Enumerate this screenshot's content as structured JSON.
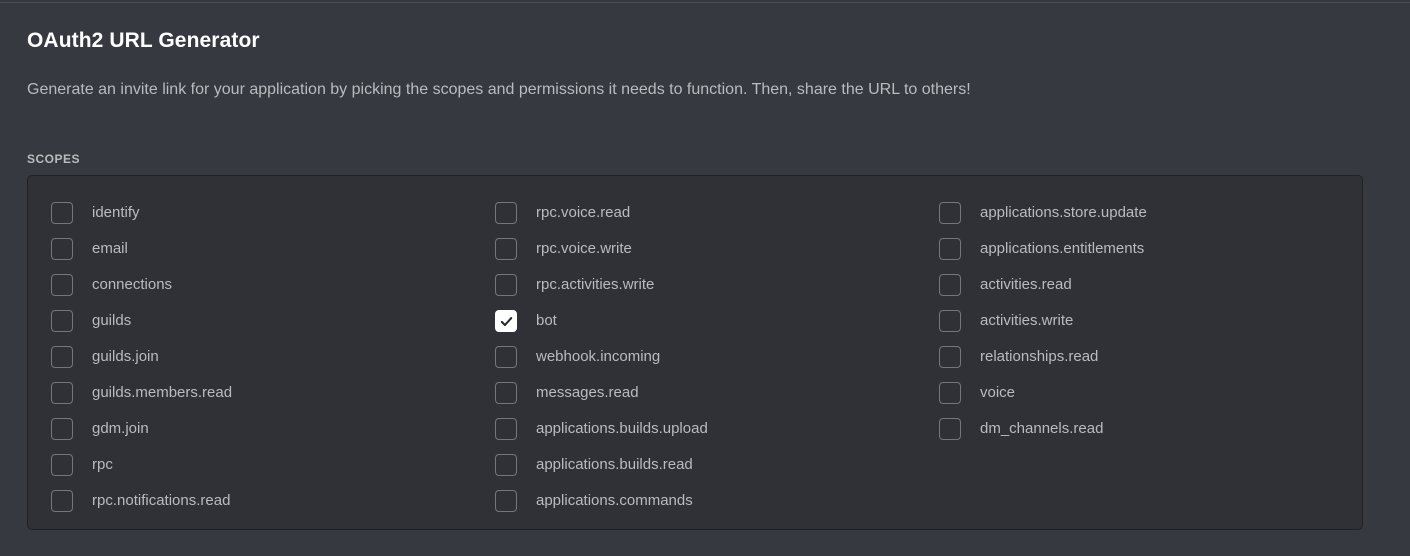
{
  "header": {
    "title": "OAuth2 URL Generator",
    "description": "Generate an invite link for your application by picking the scopes and permissions it needs to function. Then, share the URL to others!"
  },
  "scopes_section": {
    "label": "SCOPES",
    "columns": [
      {
        "items": [
          {
            "label": "identify",
            "checked": false
          },
          {
            "label": "email",
            "checked": false
          },
          {
            "label": "connections",
            "checked": false
          },
          {
            "label": "guilds",
            "checked": false
          },
          {
            "label": "guilds.join",
            "checked": false
          },
          {
            "label": "guilds.members.read",
            "checked": false
          },
          {
            "label": "gdm.join",
            "checked": false
          },
          {
            "label": "rpc",
            "checked": false
          },
          {
            "label": "rpc.notifications.read",
            "checked": false
          }
        ]
      },
      {
        "items": [
          {
            "label": "rpc.voice.read",
            "checked": false
          },
          {
            "label": "rpc.voice.write",
            "checked": false
          },
          {
            "label": "rpc.activities.write",
            "checked": false
          },
          {
            "label": "bot",
            "checked": true
          },
          {
            "label": "webhook.incoming",
            "checked": false
          },
          {
            "label": "messages.read",
            "checked": false
          },
          {
            "label": "applications.builds.upload",
            "checked": false
          },
          {
            "label": "applications.builds.read",
            "checked": false
          }
        ]
      },
      {
        "items": [
          {
            "label": "applications.commands",
            "checked": false
          },
          {
            "label": "applications.store.update",
            "checked": false
          },
          {
            "label": "applications.entitlements",
            "checked": false
          },
          {
            "label": "activities.read",
            "checked": false
          },
          {
            "label": "activities.write",
            "checked": false
          },
          {
            "label": "relationships.read",
            "checked": false
          },
          {
            "label": "voice",
            "checked": false
          },
          {
            "label": "dm_channels.read",
            "checked": false
          }
        ]
      }
    ]
  },
  "colors": {
    "page_background": "#36393f",
    "panel_background": "#2f3136",
    "panel_border": "#202225",
    "title_text": "#ffffff",
    "body_text": "#b9bbbe",
    "checkbox_border": "#72767d",
    "checkbox_checked_background": "#ffffff",
    "checkbox_tick": "#23262a"
  }
}
